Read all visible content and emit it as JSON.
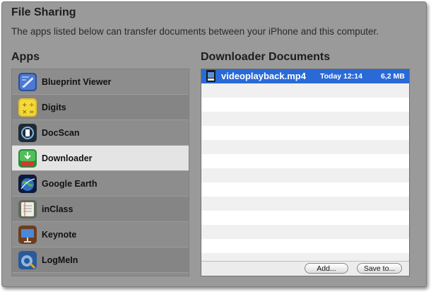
{
  "file_sharing": {
    "title": "File Sharing",
    "description": "The apps listed below can transfer documents between your iPhone and this computer."
  },
  "apps": {
    "title": "Apps",
    "items": [
      {
        "label": "Blueprint Viewer",
        "icon": "blueprint-viewer-app-icon"
      },
      {
        "label": "Digits",
        "icon": "digits-calculator-app-icon"
      },
      {
        "label": "DocScan",
        "icon": "docscan-app-icon"
      },
      {
        "label": "Downloader",
        "icon": "downloader-app-icon",
        "selected": true
      },
      {
        "label": "Google Earth",
        "icon": "google-earth-app-icon"
      },
      {
        "label": "inClass",
        "icon": "inclass-app-icon"
      },
      {
        "label": "Keynote",
        "icon": "keynote-app-icon"
      },
      {
        "label": "LogMeIn",
        "icon": "logmein-app-icon"
      }
    ]
  },
  "documents": {
    "title": "Downloader Documents",
    "files": [
      {
        "name": "videoplayback.mp4",
        "date": "Today 12:14",
        "size": "6,2 MB",
        "selected": true
      }
    ],
    "add_button": "Add...",
    "save_button": "Save to..."
  },
  "colors": {
    "panel_bg": "#9a9a9a",
    "selection_blue": "#2a6ad7"
  }
}
